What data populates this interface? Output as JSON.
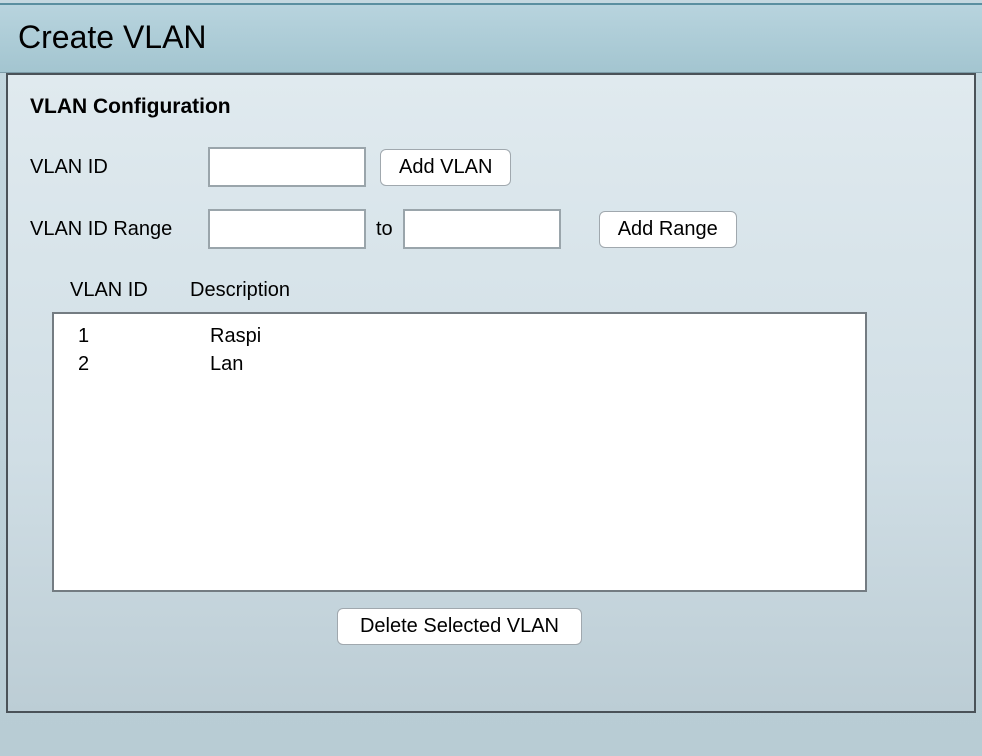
{
  "header": {
    "title": "Create VLAN"
  },
  "panel": {
    "section_title": "VLAN Configuration",
    "vlan_id_label": "VLAN ID",
    "vlan_id_value": "",
    "add_vlan_label": "Add VLAN",
    "vlan_range_label": "VLAN ID Range",
    "vlan_range_from_value": "",
    "to_label": "to",
    "vlan_range_to_value": "",
    "add_range_label": "Add Range",
    "table": {
      "col_id": "VLAN ID",
      "col_desc": "Description",
      "rows": [
        {
          "id": "1",
          "desc": "Raspi"
        },
        {
          "id": "2",
          "desc": " Lan"
        }
      ]
    },
    "delete_label": "Delete Selected VLAN"
  }
}
